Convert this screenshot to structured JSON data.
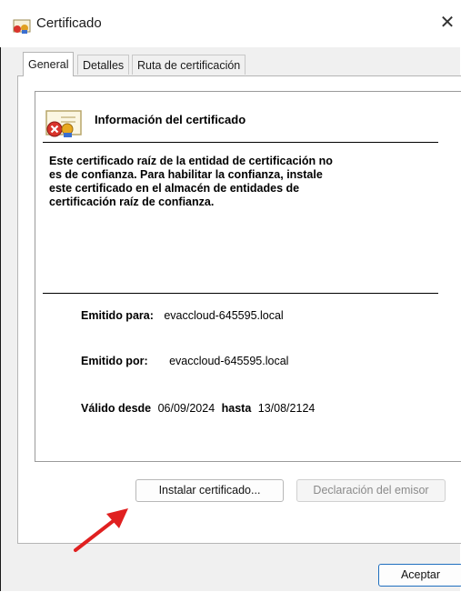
{
  "window": {
    "title": "Certificado",
    "close_glyph": "✕"
  },
  "tabs": [
    {
      "label": "General",
      "active": true
    },
    {
      "label": "Detalles",
      "active": false
    },
    {
      "label": "Ruta de certificación",
      "active": false
    }
  ],
  "info": {
    "heading": "Información del certificado",
    "message_lines": [
      "Este certificado raíz de la entidad de certificación no",
      "es de confianza. Para habilitar la confianza, instale",
      "este certificado en el almacén de entidades de",
      "certificación raíz de confianza."
    ],
    "issued_to_label": "Emitido para:",
    "issued_to_value": "evaccloud-645595.local",
    "issued_by_label": "Emitido por:",
    "issued_by_value": "evaccloud-645595.local",
    "valid_from_label": "Válido desde",
    "valid_from_value": "06/09/2024",
    "valid_to_label": "hasta",
    "valid_to_value": "13/08/2124"
  },
  "buttons": {
    "install": "Instalar certificado...",
    "issuer_statement": "Declaración del emisor",
    "ok": "Aceptar"
  },
  "colors": {
    "annotation_arrow": "#e02020",
    "ok_border": "#1f6fbf"
  },
  "icons": {
    "title": "certificate-icon",
    "info": "certificate-error-icon",
    "annotation": "red-arrow-icon"
  }
}
